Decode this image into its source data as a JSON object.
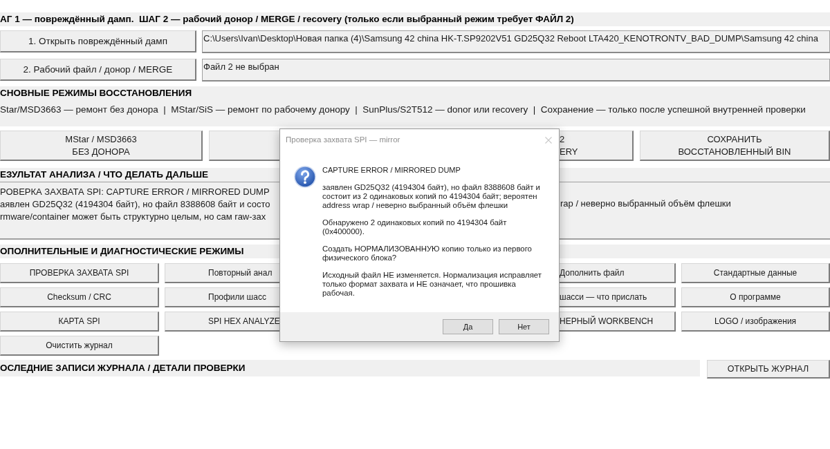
{
  "steps": {
    "heading": "АГ 1 — повреждённый дамп.  ШАГ 2 — рабочий донор / MERGE / recovery (только если выбранный режим требует ФАЙЛ 2)",
    "rows": [
      {
        "button": "1. Открыть повреждённый дамп",
        "path": "C:\\Users\\Ivan\\Desktop\\Новая папка (4)\\Samsung 42 china HK-T.SP9202V51 GD25Q32 Reboot LTA420_KENOTRONTV_BAD_DUMP\\Samsung 42 china"
      },
      {
        "button": "2. Рабочий файл / донор / MERGE",
        "path": "Файл 2 не выбран"
      }
    ]
  },
  "recovery_modes": {
    "heading": "СНОВНЫЕ РЕЖИМЫ ВОССТАНОВЛЕНИЯ",
    "summary": "Star/MSD3663 — ремонт без донора  |  MStar/SiS — ремонт по рабочему донору  |  SunPlus/S2T512 — donor или recovery  |  Сохранение — только после успешной внутренней проверки",
    "buttons": [
      {
        "kind": "full",
        "lines": [
          "MStar / MSD3663",
          "БЕЗ ДОНОРА"
        ]
      },
      {
        "kind": "covered"
      },
      {
        "kind": "partial",
        "lines": [
          "2",
          "ERY"
        ]
      },
      {
        "kind": "full",
        "lines": [
          "СОХРАНИТЬ",
          "ВОССТАНОВЛЕННЫЙ BIN"
        ]
      }
    ]
  },
  "analysis": {
    "heading": "ЕЗУЛЬТАТ АНАЛИЗА / ЧТО ДЕЛАТЬ ДАЛЬШЕ",
    "lines": [
      {
        "left": "РОВЕРКА ЗАХВАТА SPI: CAPTURE ERROR / MIRRORED DUMP"
      },
      {
        "left": "аявлен GD25Q32 (4194304 байт), но файл 8388608 байт и состо",
        "right": "rap / неверно выбранный объём флешки"
      },
      {
        "left": "rmware/container может быть структурно целым, но сам raw-зах"
      }
    ]
  },
  "tools": {
    "heading": "ОПОЛНИТЕЛЬНЫЕ И ДИАГНОСТИЧЕСКИЕ РЕЖИМЫ",
    "columns": [
      {
        "kind": "full",
        "buttons": [
          "ПРОВЕРКА ЗАХВАТА SPI",
          "Checksum / CRC",
          "КАРТА SPI",
          "Очистить журнал"
        ]
      },
      {
        "kind": "cut_right",
        "buttons": [
          "Повторный анал",
          "Профили шасс",
          "SPI HEX ANALYZE"
        ]
      },
      {
        "kind": "cut_left",
        "buttons": [
          "Дополнить файл",
          "шасси — что прислать",
          "НЕРНЫЙ WORKBENCH"
        ]
      },
      {
        "kind": "full",
        "buttons": [
          "Стандартные данные",
          "О программе",
          "LOGO / изображения"
        ]
      }
    ]
  },
  "log": {
    "heading": "ОСЛЕДНИЕ ЗАПИСИ ЖУРНАЛА / ДЕТАЛИ ПРОВЕРКИ",
    "button": "ОТКРЫТЬ ЖУРНАЛ"
  },
  "dialog": {
    "title": "Проверка захвата SPI — mirror",
    "heading": "CAPTURE ERROR / MIRRORED DUMP",
    "paragraphs": [
      "заявлен GD25Q32 (4194304 байт), но файл 8388608 байт и состоит из 2 одинаковых копий по 4194304 байт; вероятен address wrap / неверно выбранный объём флешки",
      "Обнаружено 2 одинаковых копий по 4194304 байт (0x400000).",
      "Создать НОРМАЛИЗОВАННУЮ копию только из первого физического блока?",
      "Исходный файл НЕ изменяется. Нормализация исправляет только формат захвата и НЕ означает, что прошивка рабочая."
    ],
    "buttons": [
      "Да",
      "Нет"
    ]
  }
}
